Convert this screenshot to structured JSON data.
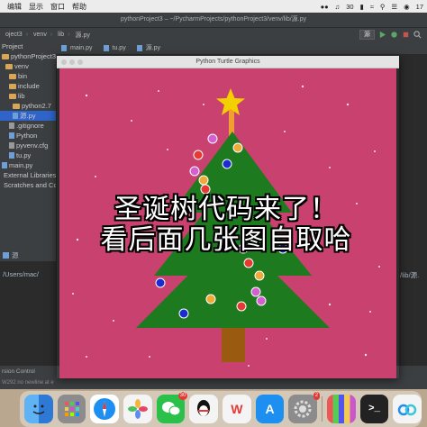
{
  "menubar": {
    "items": [
      "编辑",
      "显示",
      "窗口",
      "帮助"
    ],
    "battery": "30",
    "time": "17"
  },
  "ide": {
    "title": "pythonProject3 – ~/PycharmProjects/pythonProject3/venv/lib/源.py",
    "breadcrumbs": [
      "oject3",
      "venv",
      "lib",
      "源.py"
    ],
    "run_config": "源",
    "tabs": [
      "main.py",
      "tu.py",
      "源.py"
    ],
    "tree": [
      {
        "label": "Project",
        "type": "header"
      },
      {
        "label": "pythonProject3",
        "type": "folder"
      },
      {
        "label": "venv",
        "type": "folder"
      },
      {
        "label": "bin",
        "type": "folder"
      },
      {
        "label": "include",
        "type": "folder"
      },
      {
        "label": "lib",
        "type": "folder"
      },
      {
        "label": "python2.7",
        "type": "folder"
      },
      {
        "label": "源.py",
        "type": "file",
        "selected": true
      },
      {
        "label": ".gitignore",
        "type": "file"
      },
      {
        "label": "Python",
        "type": "file"
      },
      {
        "label": "pyvenv.cfg",
        "type": "file"
      },
      {
        "label": "tu.py",
        "type": "file"
      },
      {
        "label": "main.py",
        "type": "file"
      },
      {
        "label": "External Libraries",
        "type": "folder"
      },
      {
        "label": "Scratches and Con",
        "type": "folder"
      }
    ],
    "terminal_tab": "源",
    "terminal_left": "/Users/mac/",
    "terminal_right": "/lib/源.",
    "status_line1": "rsion Control",
    "status_line2": "W292 no newline at e"
  },
  "turtle_window": {
    "title": "Python Turtle Graphics"
  },
  "overlay_text": {
    "line1": "圣诞树代码来了！",
    "line2": "看后面几张图自取哈"
  },
  "dock": {
    "items": [
      {
        "name": "finder-icon",
        "color": "#3b8fe8"
      },
      {
        "name": "launchpad-icon",
        "color": "#8c8c8c"
      },
      {
        "name": "safari-icon",
        "color": "#1f8ef1"
      },
      {
        "name": "photos-icon",
        "color": "#f4f4f4"
      },
      {
        "name": "wechat-icon",
        "color": "#2bc04a",
        "badge": "30"
      },
      {
        "name": "qq-icon",
        "color": "#f4f4f4"
      },
      {
        "name": "wps-icon",
        "color": "#f4f4f4"
      },
      {
        "name": "app-store-icon",
        "color": "#1c8ff0"
      },
      {
        "name": "system-preferences-icon",
        "color": "#8c8c8c",
        "badge": "2"
      },
      {
        "name": "archive-icon",
        "color": "#9c6cf0"
      },
      {
        "name": "terminal-icon",
        "color": "#222222"
      },
      {
        "name": "baidu-netdisk-icon",
        "color": "#f4f4f4"
      }
    ]
  },
  "colors": {
    "canvas_bg": "#c8416f",
    "tree_green": "#1e7a1e",
    "trunk": "#9a5a10",
    "star": "#f5d000",
    "ornament_colors": [
      "#e53935",
      "#f0a93b",
      "#d35fd0",
      "#1a2bd0"
    ]
  }
}
